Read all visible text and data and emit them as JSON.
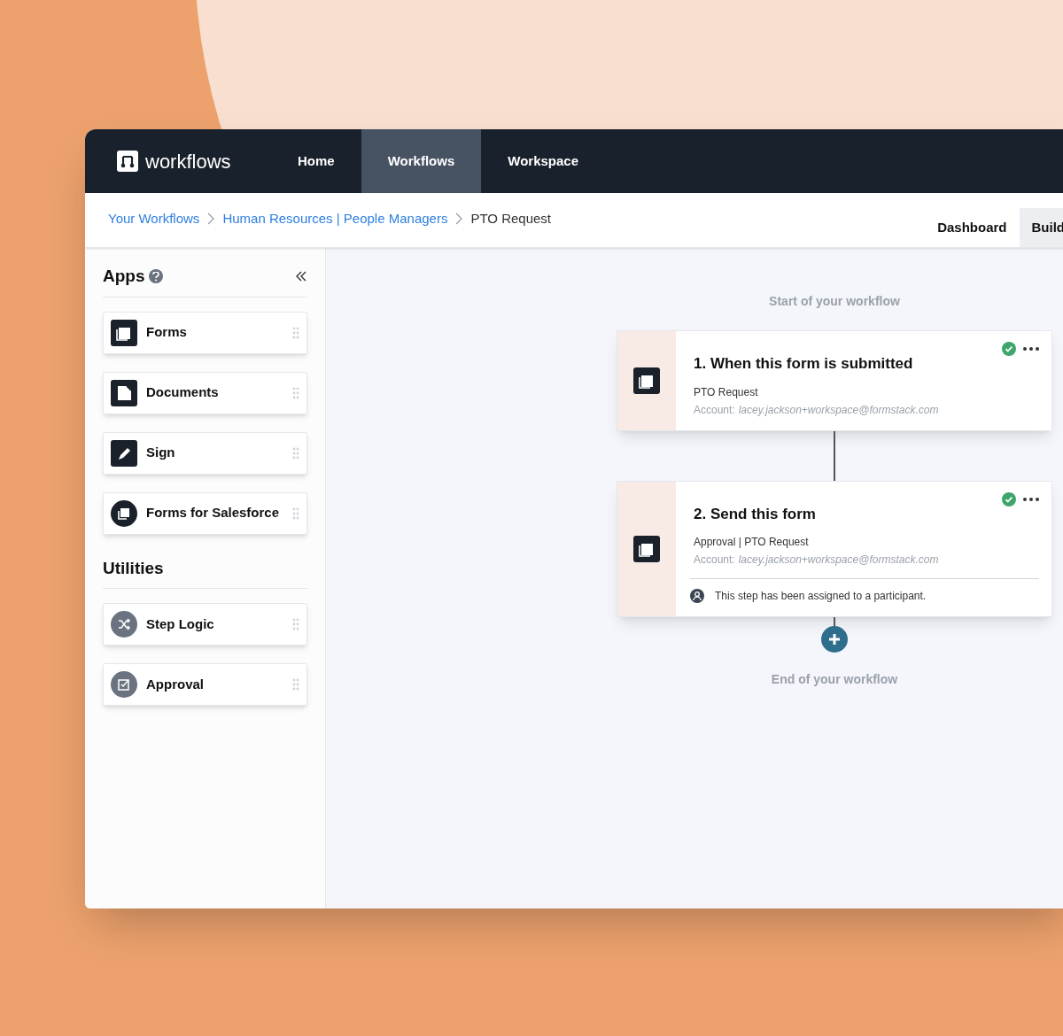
{
  "nav": {
    "logo": "workflows",
    "items": [
      {
        "label": "Home",
        "selected": false
      },
      {
        "label": "Workflows",
        "selected": true
      },
      {
        "label": "Workspace",
        "selected": false
      }
    ]
  },
  "breadcrumbs": [
    {
      "label": "Your Workflows",
      "link": true
    },
    {
      "label": "Human Resources | People Managers",
      "link": true
    },
    {
      "label": "PTO Request",
      "link": false
    }
  ],
  "view_tabs": [
    {
      "label": "Dashboard",
      "selected": false
    },
    {
      "label": "Build",
      "selected": true
    }
  ],
  "sidebar": {
    "sections": [
      {
        "title": "Apps",
        "help": true,
        "collapse": true,
        "items": [
          {
            "label": "Forms",
            "kind": "square"
          },
          {
            "label": "Documents",
            "kind": "square"
          },
          {
            "label": "Sign",
            "kind": "square"
          },
          {
            "label": "Forms for Salesforce",
            "kind": "round"
          }
        ]
      },
      {
        "title": "Utilities",
        "help": false,
        "collapse": false,
        "items": [
          {
            "label": "Step Logic",
            "kind": "utility"
          },
          {
            "label": "Approval",
            "kind": "utility"
          }
        ]
      }
    ]
  },
  "canvas": {
    "start_label": "Start of your workflow",
    "end_label": "End of your workflow",
    "steps": [
      {
        "title": "1. When this form is submitted",
        "subtitle": "PTO Request",
        "account_label": "Account:",
        "account": "lacey.jackson+workspace@formstack.com",
        "complete": true
      },
      {
        "title": "2. Send this form",
        "subtitle": "Approval | PTO Request",
        "account_label": "Account:",
        "account": "lacey.jackson+workspace@formstack.com",
        "complete": true,
        "note": "This step has been assigned to a participant."
      }
    ]
  }
}
